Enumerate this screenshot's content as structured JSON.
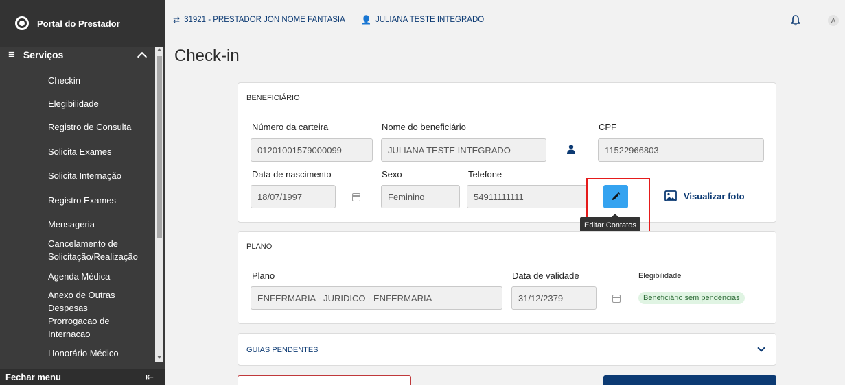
{
  "sidebar": {
    "brand": "Portal do Prestador",
    "section_label": "Serviços",
    "items": [
      {
        "label": "Checkin"
      },
      {
        "label": "Elegibilidade"
      },
      {
        "label": "Registro de Consulta"
      },
      {
        "label": "Solicita Exames"
      },
      {
        "label": "Solicita Internação"
      },
      {
        "label": "Registro Exames"
      },
      {
        "label": "Mensageria"
      },
      {
        "label": "Cancelamento de Solicitação/Realização"
      },
      {
        "label": "Agenda Médica"
      },
      {
        "label": "Anexo de Outras Despesas"
      },
      {
        "label": "Prorrogacao de Internacao"
      },
      {
        "label": "Honorário Médico"
      }
    ],
    "footer_label": "Fechar menu"
  },
  "topbar": {
    "provider": "31921 - PRESTADOR JON NOME FANTASIA",
    "user": "JULIANA TESTE INTEGRADO",
    "avatar_initial": "A"
  },
  "page": {
    "title": "Check-in"
  },
  "beneficiario": {
    "section_title": "BENEFICIÁRIO",
    "carteira_label": "Número da carteira",
    "carteira_value": "01201001579000099",
    "nome_label": "Nome do beneficiário",
    "nome_value": "JULIANA TESTE INTEGRADO",
    "cpf_label": "CPF",
    "cpf_value": "11522966803",
    "nascimento_label": "Data de nascimento",
    "nascimento_value": "18/07/1997",
    "sexo_label": "Sexo",
    "sexo_value": "Feminino",
    "telefone_label": "Telefone",
    "telefone_value": "54911111111",
    "tooltip": "Editar Contatos",
    "photo_link": "Visualizar foto"
  },
  "plano": {
    "section_title": "PLANO",
    "plano_label": "Plano",
    "plano_value": "ENFERMARIA - JURIDICO - ENFERMARIA",
    "validade_label": "Data de validade",
    "validade_value": "31/12/2379",
    "elegibilidade_label": "Elegibilidade",
    "elegibilidade_badge": "Beneficiário sem pendências"
  },
  "guias": {
    "section_title": "GUIAS PENDENTES"
  },
  "colors": {
    "sidebar_bg": "#3b3b3b",
    "accent_blue": "#0c3a73",
    "edit_button": "#35a3f0",
    "highlight_red": "#e51b1b",
    "badge_green": "#e0f4e3"
  }
}
